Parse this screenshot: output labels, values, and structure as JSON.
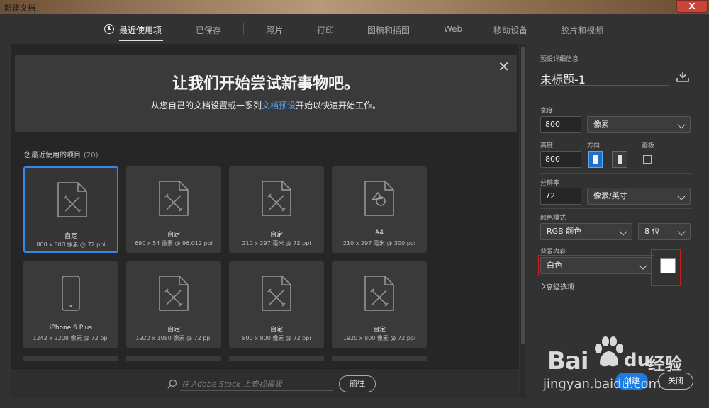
{
  "window": {
    "title": "新建文档",
    "close_label": "X"
  },
  "tabs": [
    {
      "label": "最近使用项",
      "active": true
    },
    {
      "label": "已保存"
    },
    {
      "label": "照片"
    },
    {
      "label": "打印"
    },
    {
      "label": "图稿和插图"
    },
    {
      "label": "Web"
    },
    {
      "label": "移动设备"
    },
    {
      "label": "胶片和视频"
    }
  ],
  "banner": {
    "headline": "让我们开始尝试新事物吧。",
    "sub_before": "从您自己的文档设置或一系列",
    "sub_link": "文档预设",
    "sub_after": "开始以快速开始工作。"
  },
  "recent": {
    "label": "您最近使用的项目",
    "count": "(20)"
  },
  "cards": [
    {
      "name": "自定",
      "meta": "800 x 800 像素 @ 72 ppi",
      "icon": "custom-doc-icon"
    },
    {
      "name": "自定",
      "meta": "690 x 54 像素 @ 96.012 ppi",
      "icon": "custom-doc-icon"
    },
    {
      "name": "自定",
      "meta": "210 x 297 毫米 @ 72 ppi",
      "icon": "custom-doc-icon"
    },
    {
      "name": "A4",
      "meta": "210 x 297 毫米 @ 300 ppi",
      "icon": "print-doc-icon"
    },
    {
      "name": "iPhone 6 Plus",
      "meta": "1242 x 2208 像素 @ 72 ppi",
      "icon": "phone-icon"
    },
    {
      "name": "自定",
      "meta": "1920 x 1080 像素 @ 72 ppi",
      "icon": "custom-doc-icon"
    },
    {
      "name": "自定",
      "meta": "800 x 800 像素 @ 72 ppi",
      "icon": "custom-doc-icon"
    },
    {
      "name": "自定",
      "meta": "1920 x 800 像素 @ 72 ppi",
      "icon": "custom-doc-icon"
    }
  ],
  "search": {
    "placeholder": "在 Adobe Stock 上查找模板",
    "go_label": "前往"
  },
  "preset": {
    "section_label": "预设详细信息",
    "doc_name": "未标题-1",
    "width_label": "宽度",
    "width_value": "800",
    "width_unit": "像素",
    "height_label": "高度",
    "height_value": "800",
    "orientation_label": "方向",
    "artboard_label": "画板",
    "resolution_label": "分辨率",
    "resolution_value": "72",
    "resolution_unit": "像素/英寸",
    "color_mode_label": "颜色模式",
    "color_mode_value": "RGB 颜色",
    "bit_depth": "8 位",
    "background_label": "背景内容",
    "background_value": "白色",
    "background_color": "#ffffff",
    "advanced_label": "高级选项"
  },
  "actions": {
    "create_label": "创建",
    "close_label": "关闭"
  },
  "watermark": {
    "left": "Bai",
    "du": "du",
    "cn": "经验",
    "url": "jingyan.baidu.com"
  },
  "colors": {
    "accent": "#1c7ce0",
    "highlight_box": "#d21a1a"
  }
}
